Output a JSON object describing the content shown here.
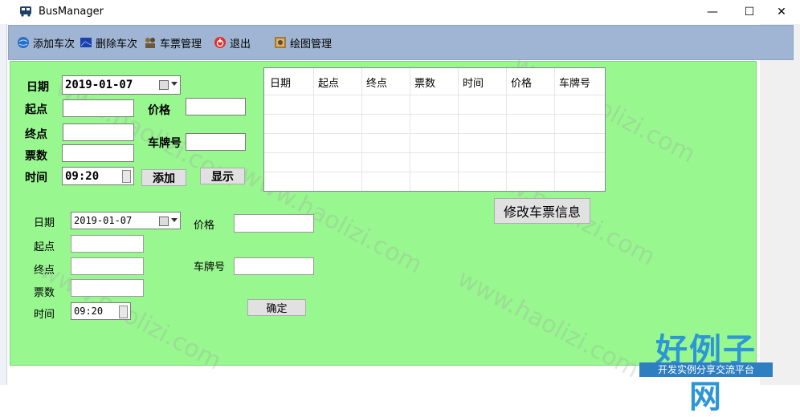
{
  "window": {
    "title": "BusManager",
    "controls": {
      "minimize": "—",
      "maximize": "☐",
      "close": "✕"
    }
  },
  "toolbar": {
    "items": [
      {
        "label": "添加车次",
        "icon": "globe-icon"
      },
      {
        "label": "删除车次",
        "icon": "image-icon"
      },
      {
        "label": "车票管理",
        "icon": "people-icon"
      },
      {
        "label": "退出",
        "icon": "power-icon"
      },
      {
        "label": "绘图管理",
        "icon": "picture-icon"
      }
    ]
  },
  "add_form": {
    "date_label": "日期",
    "date_value": "2019-01-07",
    "start_label": "起点",
    "start_value": "",
    "price_label": "价格",
    "price_value": "",
    "end_label": "终点",
    "end_value": "",
    "plate_label": "车牌号",
    "plate_value": "",
    "tickets_label": "票数",
    "tickets_value": "",
    "time_label": "时间",
    "time_value": "09:20",
    "add_button": "添加",
    "show_button": "显示"
  },
  "grid": {
    "columns": [
      "日期",
      "起点",
      "终点",
      "票数",
      "时间",
      "价格",
      "车牌号"
    ]
  },
  "modify_button": "修改车票信息",
  "edit_form": {
    "date_label": "日期",
    "date_value": "2019-01-07",
    "price_label": "价格",
    "price_value": "",
    "start_label": "起点",
    "start_value": "",
    "end_label": "终点",
    "end_value": "",
    "plate_label": "车牌号",
    "plate_value": "",
    "tickets_label": "票数",
    "tickets_value": "",
    "time_label": "时间",
    "time_value": "09:20",
    "confirm_button": "确定"
  },
  "watermark": {
    "text": "www.haolizi.com",
    "brand": "好例子网",
    "brand_sub": "开发实例分享交流平台"
  },
  "colors": {
    "panel_bg": "#98f78f",
    "toolbar_bg": "#9fb5d3",
    "brand": "#2d96d6"
  }
}
